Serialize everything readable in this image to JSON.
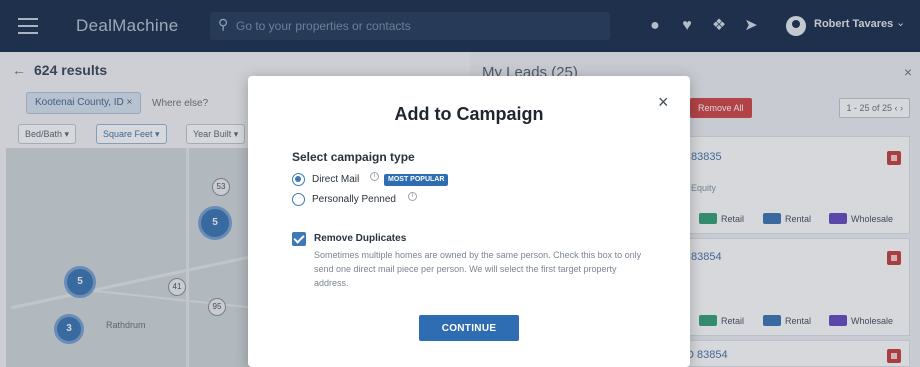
{
  "header": {
    "logo": "DealMachine",
    "search_placeholder": "Go to your properties or contacts",
    "user_name": "Robert Tavares",
    "icons": [
      "menu-icon",
      "compass-icon",
      "heart-icon",
      "pin-icon",
      "rocket-icon",
      "user-icon",
      "chevron-down-icon"
    ]
  },
  "left": {
    "results": "624 results",
    "filter_chip": "Kootenai County, ID",
    "where_placeholder": "Where else?",
    "filters": [
      "Bed/Bath",
      "Square Feet",
      "Year Built"
    ],
    "map": {
      "clusters": [
        "5",
        "5",
        "3"
      ],
      "labels": [
        "Rathdrum"
      ],
      "shields": [
        "53",
        "41",
        "95"
      ]
    }
  },
  "right": {
    "title": "My Leads (25)",
    "remove_all": "Remove All",
    "pager": "1 - 25 of 25",
    "cards": [
      {
        "id": "83835",
        "sub": "Equity"
      },
      {
        "id": "83854",
        "sub": ""
      },
      {
        "id": "ID 83854",
        "sub": ""
      }
    ],
    "tags": [
      "Retail",
      "Rental",
      "Wholesale"
    ],
    "tag_colors": {
      "retail": "#3aa37a",
      "rental": "#3f78b6",
      "wholesale": "#6a4fc4"
    }
  },
  "modal": {
    "title": "Add to Campaign",
    "section_label": "Select campaign type",
    "options": [
      {
        "label": "Direct Mail",
        "badge": "MOST POPULAR",
        "checked": true
      },
      {
        "label": "Personally Penned",
        "checked": false
      }
    ],
    "checkbox_label": "Remove Duplicates",
    "checkbox_description": "Sometimes multiple homes are owned by the same person. Check this box to only send one direct mail piece per person. We will select the first target property address.",
    "continue_label": "CONTINUE",
    "accent_color": "#2e6db2"
  }
}
